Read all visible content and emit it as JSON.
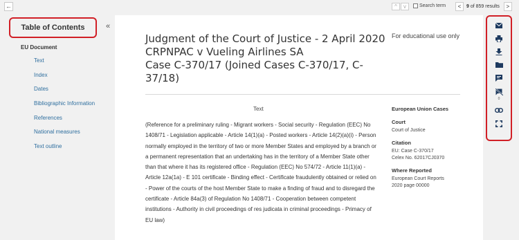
{
  "topbar": {
    "back_icon": "←",
    "prev_hit_icon": "^",
    "next_hit_icon": "v",
    "search_term_label": "Search term",
    "prev_result_icon": "<",
    "next_result_icon": ">",
    "results_current": "9",
    "results_sep": " of ",
    "results_total": "859",
    "results_suffix": " results"
  },
  "sidebar": {
    "toc_label": "Table of Contents",
    "collapse_icon": "«",
    "doc_label": "EU Document",
    "items": [
      {
        "label": "Text"
      },
      {
        "label": "Index"
      },
      {
        "label": "Dates"
      },
      {
        "label": "Bibliographic Information"
      },
      {
        "label": "References"
      },
      {
        "label": "National measures"
      },
      {
        "label": "Text outline"
      }
    ]
  },
  "document": {
    "title_line1": "Judgment of the Court of Justice - 2 April 2020",
    "title_line2": "CRPNPAC v Vueling Airlines SA",
    "title_line3": "Case C-370/17 (Joined Cases C-370/17, C-37/18)",
    "edu_note": "For educational use only",
    "text_heading": "Text",
    "body": "(Reference for a preliminary ruling - Migrant workers - Social security - Regulation (EEC) No 1408/71 - Legislation applicable - Article 14(1)(a) - Posted workers - Article 14(2)(a)(i) - Person normally employed in the territory of two or more Member States and employed by a branch or a permanent representation that an undertaking has in the territory of a Member State other than that where it has its registered office - Regulation (EEC) No 574/72 - Article 11(1)(a) - Article 12a(1a) - E 101 certificate - Binding effect - Certificate fraudulently obtained or relied on - Power of the courts of the host Member State to make a finding of fraud and to disregard the certificate - Article 84a(3) of Regulation No 1408/71 - Cooperation between competent institutions - Authority in civil proceedings of res judicata in criminal proceedings - Primacy of EU law)"
  },
  "meta": {
    "section_title": "European Union Cases",
    "court_label": "Court",
    "court_value": "Court of Justice",
    "citation_label": "Citation",
    "citation_line1": "EU: Case C-370/17",
    "citation_line2": "Celex No. 62017CJ0370",
    "reported_label": "Where Reported",
    "reported_line1": "European Court Reports",
    "reported_line2": "2020 page 00000"
  },
  "toolbar": {
    "icons": [
      "email-icon",
      "print-icon",
      "download-icon",
      "folder-icon",
      "annotate-icon",
      "hide-annotations-icon",
      "link-icon",
      "fullscreen-icon"
    ],
    "hide_annotations_count": "0"
  }
}
